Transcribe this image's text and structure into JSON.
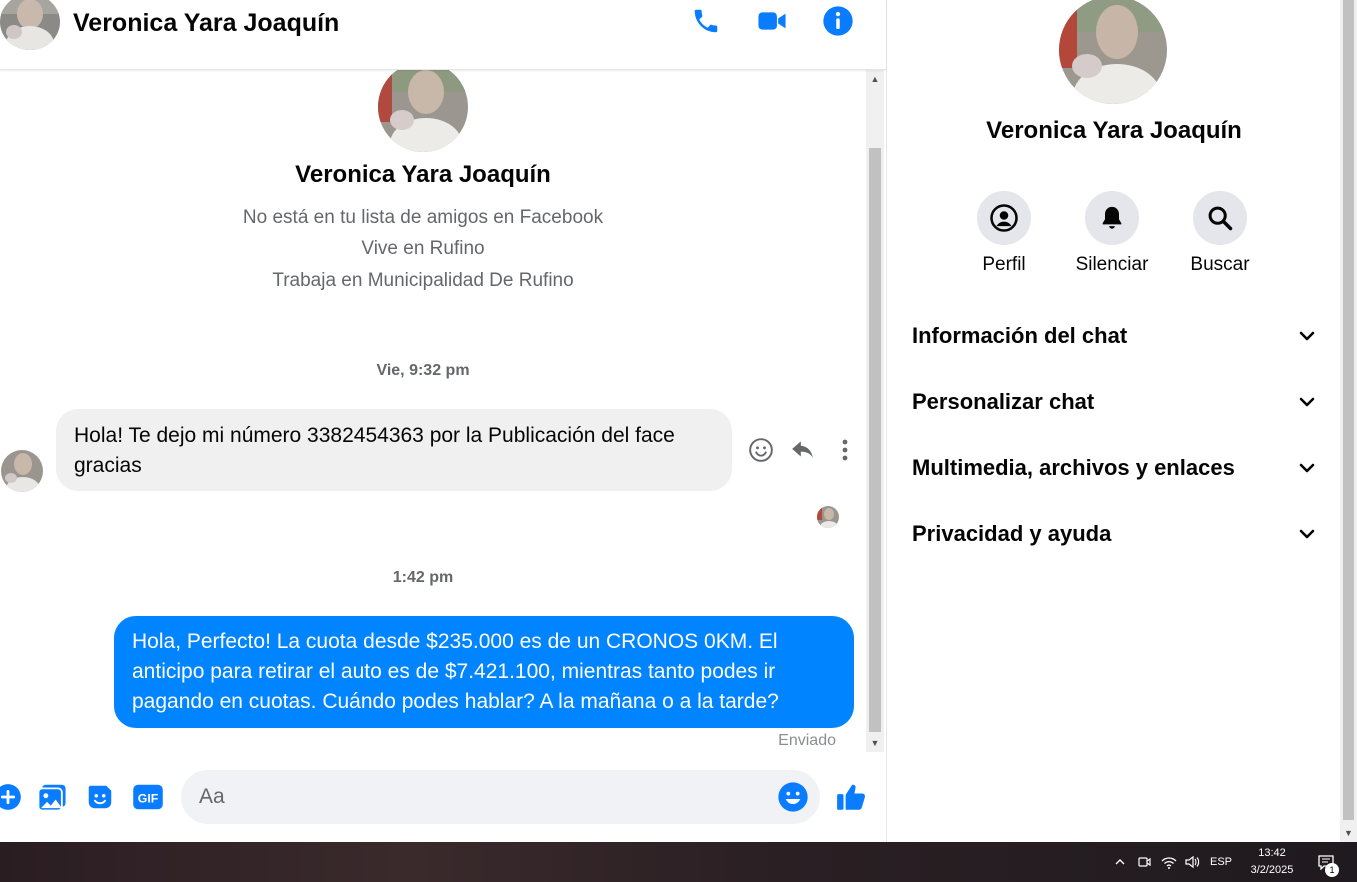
{
  "header": {
    "contact_name": "Veronica Yara Joaquín",
    "call_icon": "phone-icon",
    "video_icon": "video-camera-icon",
    "info_icon": "info-icon"
  },
  "intro": {
    "name": "Veronica Yara Joaquín",
    "lines": [
      "No está en tu lista de amigos en Facebook",
      "Vive en Rufino",
      "Trabaja en Municipalidad De Rufino"
    ]
  },
  "conversation": {
    "timestamp_1": "Vie, 9:32 pm",
    "incoming_message": "Hola! Te dejo mi número 3382454363  por la Publicación del face gracias",
    "timestamp_2": "1:42 pm",
    "outgoing_message": "Hola, Perfecto! La cuota desde $235.000 es de un CRONOS 0KM. El anticipo para retirar el auto es de $7.421.100, mientras tanto podes ir pagando en cuotas. Cuándo podes hablar? A la mañana o a la tarde?",
    "sent_status": "Enviado"
  },
  "composer": {
    "placeholder": "Aa",
    "value": ""
  },
  "panel": {
    "name": "Veronica Yara Joaquín",
    "actions": [
      {
        "label": "Perfil",
        "icon": "profile-icon"
      },
      {
        "label": "Silenciar",
        "icon": "bell-icon"
      },
      {
        "label": "Buscar",
        "icon": "search-icon"
      }
    ],
    "sections": [
      "Información del chat",
      "Personalizar chat",
      "Multimedia, archivos y enlaces",
      "Privacidad y ayuda"
    ]
  },
  "taskbar": {
    "language": "ESP",
    "time": "13:42",
    "date": "3/2/2025",
    "notification_count": "1"
  },
  "colors": {
    "accent": "#0084ff",
    "incoming_bubble": "#f0f0f0",
    "secondary_text": "#65676b"
  }
}
